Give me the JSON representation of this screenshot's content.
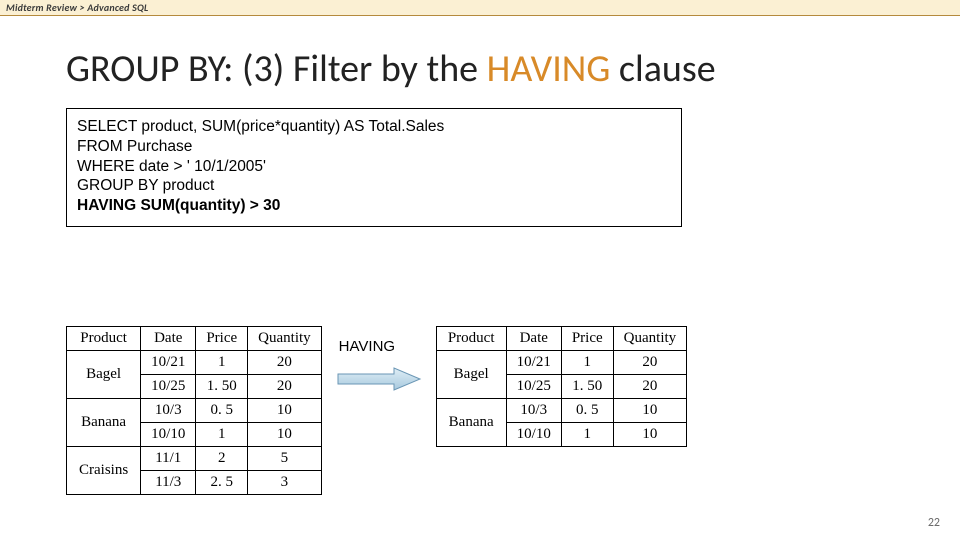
{
  "breadcrumb": "Midterm Review  >  Advanced SQL",
  "title_pre": "GROUP BY: (3) Filter by the ",
  "title_accent": "HAVING",
  "title_post": " clause",
  "sql": {
    "l1a": "SELECT   product, SUM(price*quantity) AS Total.Sales",
    "l2": "FROM     Purchase",
    "l3": "WHERE    date > ' 10/1/2005'",
    "l4": "GROUP BY product",
    "l5": "HAVING SUM(quantity) > 30"
  },
  "arrow_label": "HAVING",
  "headers": {
    "product": "Product",
    "date": "Date",
    "price": "Price",
    "quantity": "Quantity"
  },
  "left_table": [
    {
      "product": "Bagel",
      "rows": [
        {
          "date": "10/21",
          "price": "1",
          "qty": "20"
        },
        {
          "date": "10/25",
          "price": "1. 50",
          "qty": "20"
        }
      ]
    },
    {
      "product": "Banana",
      "rows": [
        {
          "date": "10/3",
          "price": "0. 5",
          "qty": "10"
        },
        {
          "date": "10/10",
          "price": "1",
          "qty": "10"
        }
      ]
    },
    {
      "product": "Craisins",
      "rows": [
        {
          "date": "11/1",
          "price": "2",
          "qty": "5"
        },
        {
          "date": "11/3",
          "price": "2. 5",
          "qty": "3"
        }
      ]
    }
  ],
  "right_table": [
    {
      "product": "Bagel",
      "rows": [
        {
          "date": "10/21",
          "price": "1",
          "qty": "20"
        },
        {
          "date": "10/25",
          "price": "1. 50",
          "qty": "20"
        }
      ]
    },
    {
      "product": "Banana",
      "rows": [
        {
          "date": "10/3",
          "price": "0. 5",
          "qty": "10"
        },
        {
          "date": "10/10",
          "price": "1",
          "qty": "10"
        }
      ]
    }
  ],
  "page_number": "22"
}
